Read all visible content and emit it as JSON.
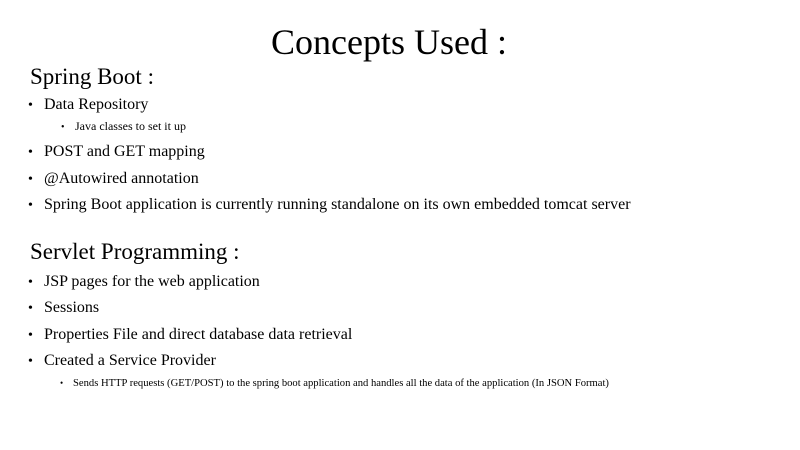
{
  "slide": {
    "title": "Concepts Used :",
    "sections": [
      {
        "heading": "Spring Boot :",
        "items": [
          {
            "text": "Data Repository",
            "subitems": [
              "Java classes to set it up"
            ]
          },
          {
            "text": "POST and GET mapping"
          },
          {
            "text": "@Autowired annotation"
          },
          {
            "text": "Spring Boot application is currently running standalone on its own embedded tomcat server"
          }
        ]
      },
      {
        "heading": "Servlet Programming :",
        "items": [
          {
            "text": "JSP pages for the web application"
          },
          {
            "text": "Sessions"
          },
          {
            "text": "Properties File and direct database data retrieval"
          },
          {
            "text": "Created a Service Provider",
            "subitems": [
              "Sends HTTP requests (GET/POST)  to the spring boot application and handles all the data of the application (In JSON Format)"
            ]
          }
        ]
      }
    ],
    "bullet_glyph": "•"
  }
}
